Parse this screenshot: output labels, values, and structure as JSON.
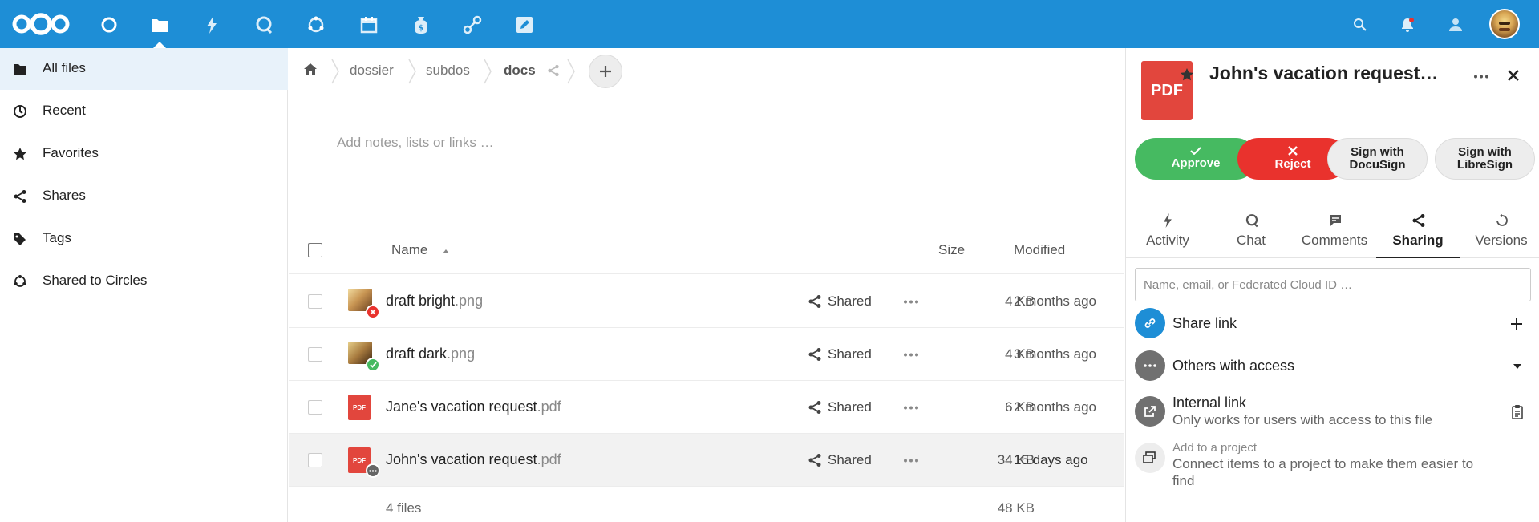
{
  "topbar": {
    "apps": [
      {
        "name": "dashboard",
        "icon": "circle-icon"
      },
      {
        "name": "files",
        "icon": "folder-icon",
        "active": true
      },
      {
        "name": "activity",
        "icon": "lightning-icon"
      },
      {
        "name": "talk",
        "icon": "chat-bubble-icon"
      },
      {
        "name": "circles",
        "icon": "circles-icon"
      },
      {
        "name": "calendar",
        "icon": "calendar-icon"
      },
      {
        "name": "money",
        "icon": "money-bag-icon"
      },
      {
        "name": "flow",
        "icon": "flow-icon"
      },
      {
        "name": "notes",
        "icon": "edit-icon"
      }
    ],
    "accent": "#1e8ed6"
  },
  "nav": {
    "items": [
      {
        "label": "All files",
        "icon": "folder-icon",
        "active": true
      },
      {
        "label": "Recent",
        "icon": "clock-icon"
      },
      {
        "label": "Favorites",
        "icon": "star-icon"
      },
      {
        "label": "Shares",
        "icon": "share-icon"
      },
      {
        "label": "Tags",
        "icon": "tag-icon"
      },
      {
        "label": "Shared to Circles",
        "icon": "circles-icon"
      }
    ]
  },
  "breadcrumb": {
    "items": [
      "dossier",
      "subdos",
      "docs"
    ]
  },
  "notes_placeholder": "Add notes, lists or links …",
  "table": {
    "headers": {
      "name": "Name",
      "size": "Size",
      "modified": "Modified"
    },
    "rows": [
      {
        "base": "draft bright",
        "ext": ".png",
        "thumb": "image",
        "badge": "reject",
        "shared": "Shared",
        "size": "4 KB",
        "modified": "2 months ago"
      },
      {
        "base": "draft dark",
        "ext": ".png",
        "thumb": "image",
        "badge": "approve",
        "shared": "Shared",
        "size": "4 KB",
        "modified": "3 months ago"
      },
      {
        "base": "Jane's vacation request",
        "ext": ".pdf",
        "thumb": "pdf",
        "badge": "",
        "shared": "Shared",
        "size": "6 KB",
        "modified": "2 months ago"
      },
      {
        "base": "John's vacation request",
        "ext": ".pdf",
        "thumb": "pdf",
        "badge": "pending",
        "shared": "Shared",
        "size": "34 KB",
        "modified": "15 days ago",
        "selected": true
      }
    ],
    "summary": {
      "count": "4 files",
      "size": "48 KB"
    },
    "pdf_label": "PDF"
  },
  "sidebar": {
    "title": "John's vacation request…",
    "file_type": "PDF",
    "actions": {
      "approve": "Approve",
      "reject": "Reject",
      "docusign_l1": "Sign with",
      "docusign_l2": "DocuSign",
      "libresign_l1": "Sign with",
      "libresign_l2": "LibreSign"
    },
    "tabs": [
      {
        "label": "Activity",
        "icon": "lightning-icon"
      },
      {
        "label": "Chat",
        "icon": "chat-bubble-icon"
      },
      {
        "label": "Comments",
        "icon": "comment-icon"
      },
      {
        "label": "Sharing",
        "icon": "share-icon",
        "active": true
      },
      {
        "label": "Versions",
        "icon": "history-icon"
      }
    ],
    "share_placeholder": "Name, email, or Federated Cloud ID …",
    "share_link": "Share link",
    "others_access": "Others with access",
    "internal_link": "Internal link",
    "internal_desc": "Only works for users with access to this file",
    "project_label": "Add to a project",
    "project_desc_l1": "Connect items to a project to make them easier to",
    "project_desc_l2": "find"
  },
  "colors": {
    "approve": "#46ba61",
    "reject": "#e9322d",
    "pdf": "#e2463d",
    "link_blue": "#1e8ed6"
  }
}
